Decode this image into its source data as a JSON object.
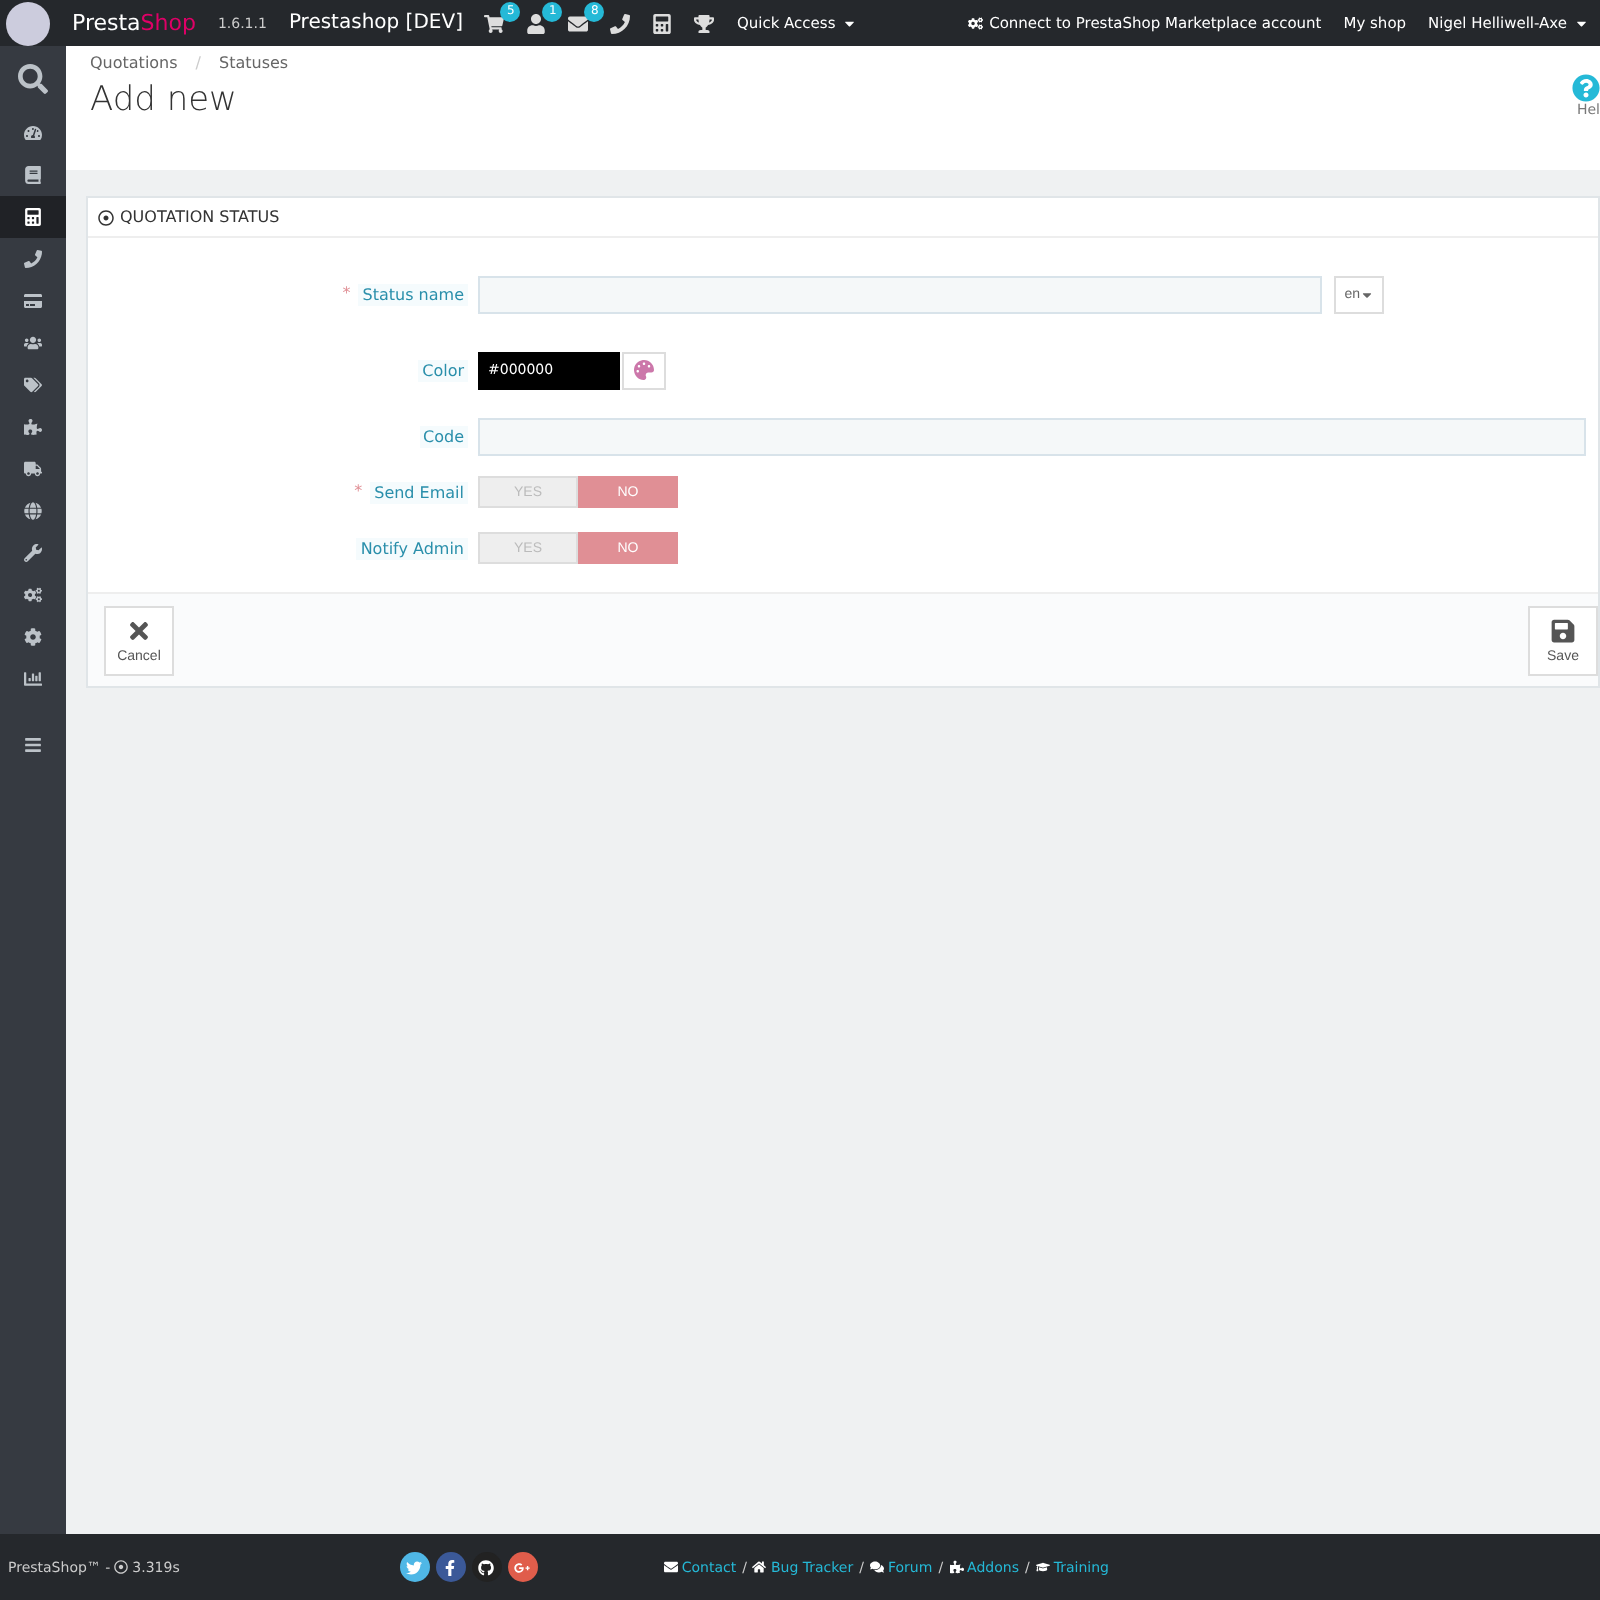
{
  "topbar": {
    "brand_first": "Presta",
    "brand_second": "Shop",
    "version": "1.6.1.1",
    "shop_title": "Prestashop [DEV]",
    "notifications": [
      {
        "badge": "5"
      },
      {
        "badge": "1"
      },
      {
        "badge": "8"
      }
    ],
    "quick_access": "Quick Access",
    "marketplace": "Connect to PrestaShop Marketplace account",
    "my_shop": "My shop",
    "user": "Nigel Helliwell-Axe"
  },
  "sidebar": {
    "items": [
      {
        "selected": false
      },
      {
        "selected": false
      },
      {
        "selected": false
      },
      {
        "selected": true
      },
      {
        "selected": false
      },
      {
        "selected": false
      },
      {
        "selected": false
      },
      {
        "selected": false
      },
      {
        "selected": false
      },
      {
        "selected": false
      },
      {
        "selected": false
      },
      {
        "selected": false
      },
      {
        "selected": false
      },
      {
        "selected": false
      },
      {
        "selected": false
      }
    ]
  },
  "header": {
    "breadcrumb": [
      {
        "label": "Quotations"
      },
      {
        "separator": "/",
        "label": "Statuses"
      }
    ],
    "title": "Add new",
    "help": "Hel"
  },
  "panel": {
    "title": "QUOTATION STATUS",
    "fields": [
      {
        "kind": "text",
        "label": "Status name",
        "required_mark": "*",
        "language": "en"
      },
      {
        "kind": "color",
        "label": "Color",
        "value": "#000000"
      },
      {
        "kind": "text",
        "label": "Code"
      },
      {
        "kind": "switch",
        "label": "Send Email",
        "required_mark": "*",
        "options": [
          {
            "label": "YES",
            "selected": false
          },
          {
            "label": "NO",
            "selected": true
          }
        ]
      },
      {
        "kind": "switch",
        "label": "Notify Admin",
        "options": [
          {
            "label": "YES",
            "selected": false
          },
          {
            "label": "NO",
            "selected": true
          }
        ]
      }
    ],
    "cancel": "Cancel",
    "save": "Save"
  },
  "footer": {
    "brand": "PrestaShop™ -",
    "time": "3.319s",
    "links": [
      {
        "label": "Contact"
      },
      {
        "separator": "/",
        "label": "Bug Tracker"
      },
      {
        "separator": "/",
        "label": "Forum"
      },
      {
        "separator": "/",
        "label": "Addons"
      },
      {
        "separator": "/",
        "label": "Training"
      }
    ]
  }
}
